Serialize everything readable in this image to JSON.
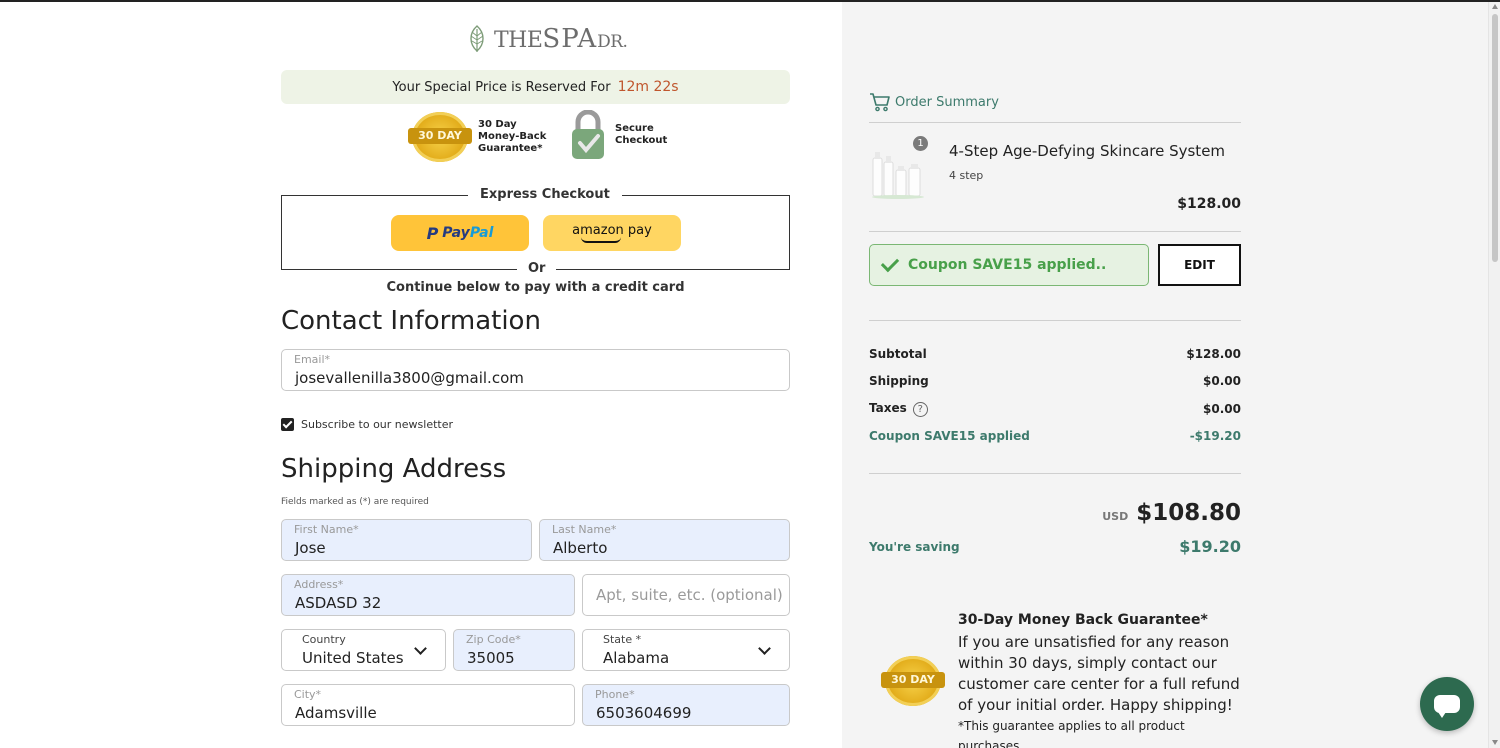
{
  "brand": {
    "logo_the": "THE",
    "logo_spa": "SPA",
    "logo_dr": "DR."
  },
  "reserved": {
    "text": "Your Special Price is Reserved For",
    "timer": "12m 22s"
  },
  "badges": {
    "seal_text": "30 DAY",
    "guarantee_lines": [
      "30 Day",
      "Money-Back",
      "Guarantee*"
    ],
    "secure_lines": [
      "Secure",
      "Checkout"
    ]
  },
  "express": {
    "title": "Express Checkout",
    "paypal_pay": "Pay",
    "paypal_pal": "Pal",
    "amazon": "amazon pay",
    "or": "Or",
    "continue": "Continue below to pay with a credit card"
  },
  "contact": {
    "title": "Contact Information",
    "email_label": "Email*",
    "email_value": "josevallenilla3800@gmail.com",
    "subscribe_label": "Subscribe to our newsletter",
    "subscribe_checked": true
  },
  "shipping": {
    "title": "Shipping Address",
    "required_note": "Fields marked as (*) are required",
    "first_name_label": "First Name*",
    "first_name": "Jose",
    "last_name_label": "Last Name*",
    "last_name": "Alberto",
    "address_label": "Address*",
    "address": "ASDASD 32",
    "apt_placeholder": "Apt, suite, etc. (optional)",
    "country_label": "Country",
    "country": "United States",
    "zip_label": "Zip Code*",
    "zip": "35005",
    "state_label": "State *",
    "state": "Alabama",
    "city_label": "City*",
    "city": "Adamsville",
    "phone_label": "Phone*",
    "phone": "6503604699"
  },
  "order": {
    "header": "Order Summary",
    "quantity": "1",
    "product_name": "4-Step Age-Defying Skincare System",
    "product_variant": "4 step",
    "product_price": "$128.00",
    "coupon_text": "Coupon SAVE15 applied..",
    "edit_label": "EDIT",
    "subtotal_label": "Subtotal",
    "subtotal": "$128.00",
    "shipping_label": "Shipping",
    "shipping": "$0.00",
    "taxes_label": "Taxes",
    "taxes": "$0.00",
    "coupon_label": "Coupon SAVE15 applied",
    "coupon_amount": "-$19.20",
    "currency": "USD",
    "total": "$108.80",
    "saving_label": "You're saving",
    "saving": "$19.20"
  },
  "guarantee": {
    "title": "30-Day Money Back Guarantee*",
    "body": "If you are unsatisfied for any reason within 30 days, simply contact our customer care center for a full refund of your initial order. Happy shipping!",
    "note": "*This guarantee applies to all product purchases."
  },
  "colors": {
    "accent_green": "#3d7a6c",
    "coupon_green": "#48a04a",
    "timer": "#c0562d",
    "paypal_yellow": "#ffc439",
    "chat": "#2d6a4f"
  },
  "icons": [
    "leaf-logo-icon",
    "gold-seal-icon",
    "lock-check-icon",
    "paypal-icon",
    "cart-icon",
    "check-icon",
    "help-icon",
    "chevron-down-icon",
    "chat-icon"
  ]
}
